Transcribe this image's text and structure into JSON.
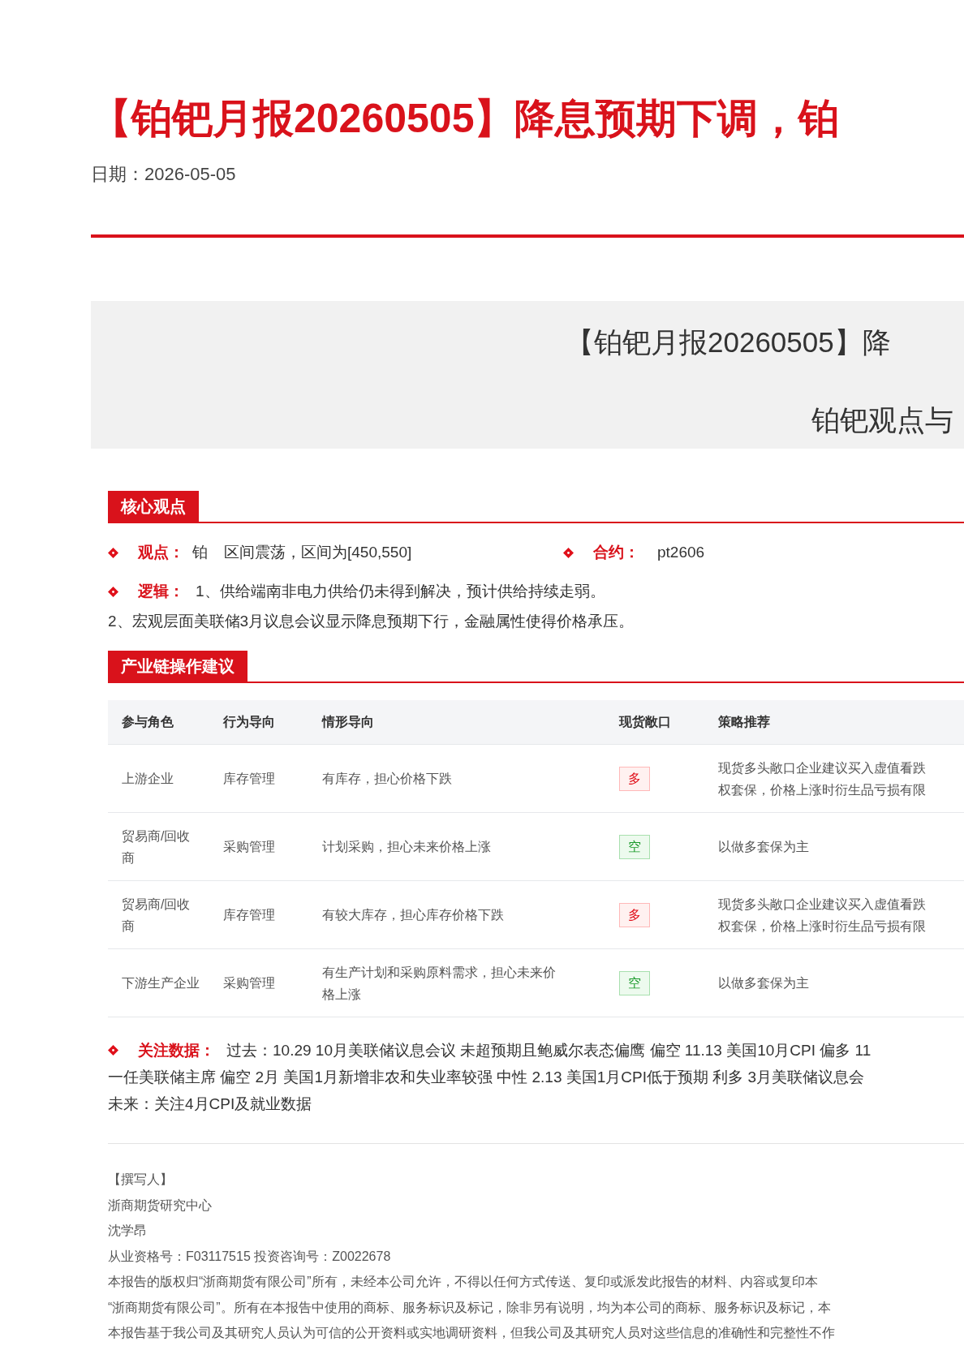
{
  "title": "【铂钯月报20260505】降息预期下调，铂",
  "date": {
    "label": "日期：",
    "value": "2026-05-05"
  },
  "banner": {
    "line_1": "【铂钯月报20260505】降",
    "line_2": "铂钯观点与"
  },
  "core_section": {
    "heading": "核心观点",
    "view": {
      "label": "观点：",
      "metal": "铂",
      "value": "区间震荡，区间为[450,550]"
    },
    "contract": {
      "label": "合约：",
      "value": "pt2606"
    },
    "logic": {
      "label": "逻辑：",
      "line_1": "1、供给端南非电力供给仍未得到解决，预计供给持续走弱。",
      "line_2": "2、宏观层面美联储3月议息会议显示降息预期下行，金融属性使得价格承压。"
    }
  },
  "chain_section": {
    "heading": "产业链操作建议",
    "table": {
      "columns": [
        "参与角色",
        "行为导向",
        "情形导向",
        "现货敞口",
        "策略推荐"
      ],
      "rows": [
        {
          "role": "上游企业",
          "behavior": "库存管理",
          "scenario": "有库存，担心价格下跌",
          "exposure": {
            "kind": "long",
            "label": "多"
          },
          "strategy": [
            "现货多头敞口企业建议买入虚值看跌",
            "权套保，价格上涨时衍生品亏损有限"
          ]
        },
        {
          "role": "贸易商/回收商",
          "behavior": "采购管理",
          "scenario": "计划采购，担心未来价格上涨",
          "exposure": {
            "kind": "short",
            "label": "空"
          },
          "strategy": [
            "以做多套保为主"
          ]
        },
        {
          "role": "贸易商/回收商",
          "behavior": "库存管理",
          "scenario": "有较大库存，担心库存价格下跌",
          "exposure": {
            "kind": "long",
            "label": "多"
          },
          "strategy": [
            "现货多头敞口企业建议买入虚值看跌",
            "权套保，价格上涨时衍生品亏损有限"
          ]
        },
        {
          "role": "下游生产企业",
          "behavior": "采购管理",
          "scenario": "有生产计划和采购原料需求，担心未来价格上涨",
          "exposure": {
            "kind": "short",
            "label": "空"
          },
          "strategy": [
            "以做多套保为主"
          ]
        }
      ]
    }
  },
  "watch_data": {
    "label": "关注数据：",
    "lines": [
      "过去：10.29 10月美联储议息会议 未超预期且鲍威尔表态偏鹰 偏空 11.13 美国10月CPI 偏多 11",
      "一任美联储主席 偏空 2月 美国1月新增非农和失业率较强 中性 2.13 美国1月CPI低于预期 利多 3月美联储议息会",
      "未来：关注4月CPI及就业数据"
    ]
  },
  "author": {
    "lines": [
      "【撰写人】",
      "浙商期货研究中心",
      "沈学昂",
      "从业资格号：F03117515 投资咨询号：Z0022678"
    ],
    "disclaimer": [
      "本报告的版权归“浙商期货有限公司”所有，未经本公司允许，不得以任何方式传送、复印或派发此报告的材料、内容或复印本",
      "“浙商期货有限公司”。所有在本报告中使用的商标、服务标识及标记，除非另有说明，均为本公司的商标、服务标识及标记，本",
      "本报告基于我公司及其研究人员认为可信的公开资料或实地调研资料，但我公司及其研究人员对这些信息的准确性和完整性不作"
    ]
  }
}
